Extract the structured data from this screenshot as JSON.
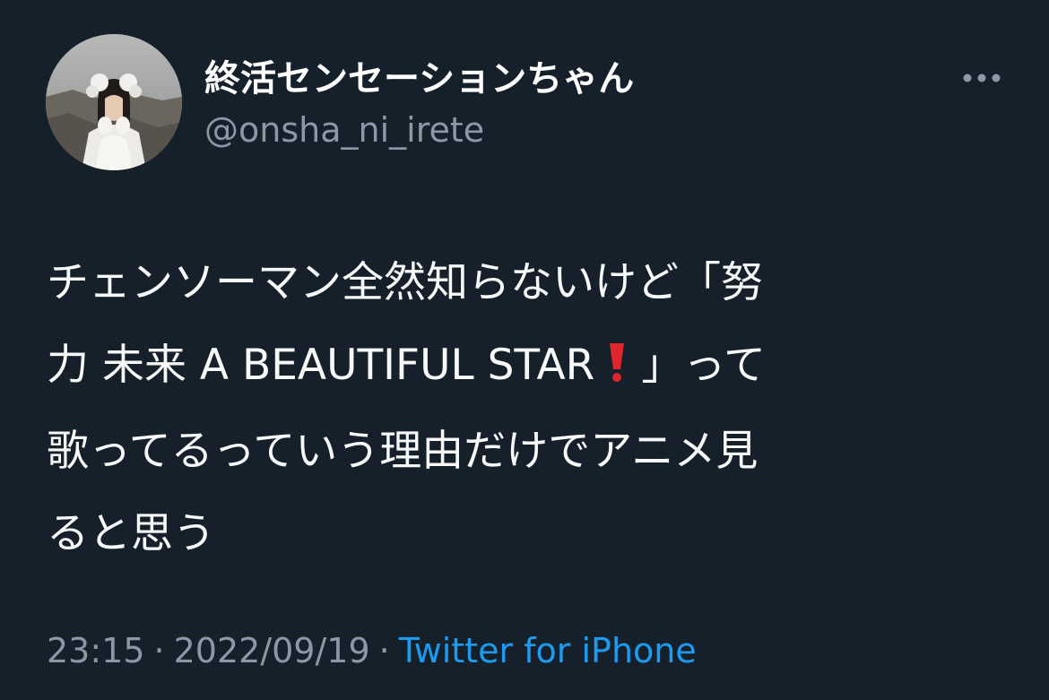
{
  "author": {
    "display_name": "終活センセーションちゃん",
    "handle": "@onsha_ni_irete"
  },
  "tweet": {
    "lines": [
      "チェンソーマン全然知らないけど「努",
      "力 未来 A BEAUTIFUL STAR",
      "」って",
      "歌ってるっていう理由だけでアニメ見",
      "ると思う"
    ],
    "emoji": "heavy-exclamation-mark-icon"
  },
  "meta": {
    "time": "23:15",
    "separator": "·",
    "date": "2022/09/19",
    "source": "Twitter for iPhone"
  },
  "colors": {
    "background": "#15202b",
    "text": "#f7f9f9",
    "secondary": "#8b98a5",
    "link": "#1d9bf0",
    "emoji_red": "#e0262d"
  }
}
